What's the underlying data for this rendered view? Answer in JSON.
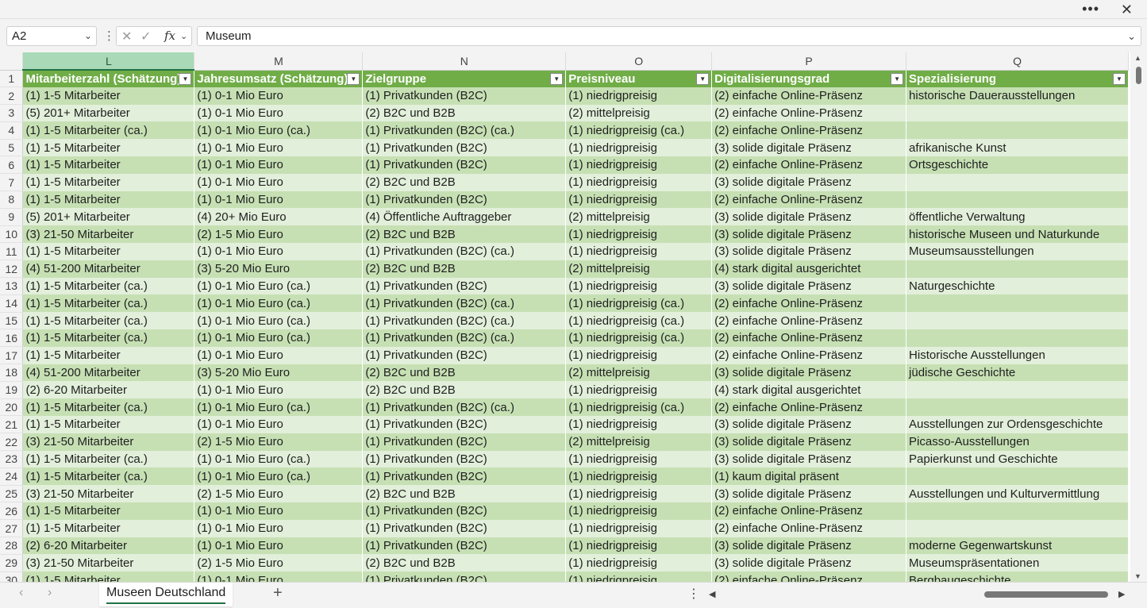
{
  "window": {
    "more_icon": "more-horizontal-icon",
    "close_icon": "close-icon"
  },
  "formula_bar": {
    "name_box": "A2",
    "formula": "Museum"
  },
  "columns": [
    "L",
    "M",
    "N",
    "O",
    "P",
    "Q"
  ],
  "active_column": "L",
  "headers": [
    "Mitarbeiterzahl (Schätzung)",
    "Jahresumsatz (Schätzung)",
    "Zielgruppe",
    "Preisniveau",
    "Digitalisierungsgrad",
    "Spezialisierung"
  ],
  "rows": [
    {
      "n": "2",
      "c": [
        "(1) 1-5 Mitarbeiter",
        "(1) 0-1 Mio Euro",
        "(1) Privatkunden (B2C)",
        "(1) niedrigpreisig",
        "(2) einfache Online-Präsenz",
        "historische Dauerausstellungen"
      ]
    },
    {
      "n": "3",
      "c": [
        "(5) 201+ Mitarbeiter",
        "(1) 0-1 Mio Euro",
        "(2) B2C und B2B",
        "(2) mittelpreisig",
        "(2) einfache Online-Präsenz",
        ""
      ]
    },
    {
      "n": "4",
      "c": [
        "(1) 1-5 Mitarbeiter (ca.)",
        "(1) 0-1 Mio Euro (ca.)",
        "(1) Privatkunden (B2C) (ca.)",
        "(1) niedrigpreisig (ca.)",
        "(2) einfache Online-Präsenz",
        ""
      ]
    },
    {
      "n": "5",
      "c": [
        "(1) 1-5 Mitarbeiter",
        "(1) 0-1 Mio Euro",
        "(1) Privatkunden (B2C)",
        "(1) niedrigpreisig",
        "(3) solide digitale Präsenz",
        "afrikanische Kunst"
      ]
    },
    {
      "n": "6",
      "c": [
        "(1) 1-5 Mitarbeiter",
        "(1) 0-1 Mio Euro",
        "(1) Privatkunden (B2C)",
        "(1) niedrigpreisig",
        "(2) einfache Online-Präsenz",
        "Ortsgeschichte"
      ]
    },
    {
      "n": "7",
      "c": [
        "(1) 1-5 Mitarbeiter",
        "(1) 0-1 Mio Euro",
        "(2) B2C und B2B",
        "(1) niedrigpreisig",
        "(3) solide digitale Präsenz",
        ""
      ]
    },
    {
      "n": "8",
      "c": [
        "(1) 1-5 Mitarbeiter",
        "(1) 0-1 Mio Euro",
        "(1) Privatkunden (B2C)",
        "(1) niedrigpreisig",
        "(2) einfache Online-Präsenz",
        ""
      ]
    },
    {
      "n": "9",
      "c": [
        "(5) 201+ Mitarbeiter",
        "(4) 20+ Mio Euro",
        "(4) Öffentliche Auftraggeber",
        "(2) mittelpreisig",
        "(3) solide digitale Präsenz",
        "öffentliche Verwaltung"
      ]
    },
    {
      "n": "10",
      "c": [
        "(3) 21-50 Mitarbeiter",
        "(2) 1-5 Mio Euro",
        "(2) B2C und B2B",
        "(1) niedrigpreisig",
        "(3) solide digitale Präsenz",
        "historische Museen und Naturkunde"
      ]
    },
    {
      "n": "11",
      "c": [
        "(1) 1-5 Mitarbeiter",
        "(1) 0-1 Mio Euro",
        "(1) Privatkunden (B2C) (ca.)",
        "(1) niedrigpreisig",
        "(3) solide digitale Präsenz",
        "Museumsausstellungen"
      ]
    },
    {
      "n": "12",
      "c": [
        "(4) 51-200 Mitarbeiter",
        "(3) 5-20 Mio Euro",
        "(2) B2C und B2B",
        "(2) mittelpreisig",
        "(4) stark digital ausgerichtet",
        ""
      ]
    },
    {
      "n": "13",
      "c": [
        "(1) 1-5 Mitarbeiter (ca.)",
        "(1) 0-1 Mio Euro (ca.)",
        "(1) Privatkunden (B2C)",
        "(1) niedrigpreisig",
        "(3) solide digitale Präsenz",
        "Naturgeschichte"
      ]
    },
    {
      "n": "14",
      "c": [
        "(1) 1-5 Mitarbeiter (ca.)",
        "(1) 0-1 Mio Euro (ca.)",
        "(1) Privatkunden (B2C) (ca.)",
        "(1) niedrigpreisig (ca.)",
        "(2) einfache Online-Präsenz",
        ""
      ]
    },
    {
      "n": "15",
      "c": [
        "(1) 1-5 Mitarbeiter (ca.)",
        "(1) 0-1 Mio Euro (ca.)",
        "(1) Privatkunden (B2C) (ca.)",
        "(1) niedrigpreisig (ca.)",
        "(2) einfache Online-Präsenz",
        ""
      ]
    },
    {
      "n": "16",
      "c": [
        "(1) 1-5 Mitarbeiter (ca.)",
        "(1) 0-1 Mio Euro (ca.)",
        "(1) Privatkunden (B2C) (ca.)",
        "(1) niedrigpreisig (ca.)",
        "(2) einfache Online-Präsenz",
        ""
      ]
    },
    {
      "n": "17",
      "c": [
        "(1) 1-5 Mitarbeiter",
        "(1) 0-1 Mio Euro",
        "(1) Privatkunden (B2C)",
        "(1) niedrigpreisig",
        "(2) einfache Online-Präsenz",
        "Historische Ausstellungen"
      ]
    },
    {
      "n": "18",
      "c": [
        "(4) 51-200 Mitarbeiter",
        "(3) 5-20 Mio Euro",
        "(2) B2C und B2B",
        "(2) mittelpreisig",
        "(3) solide digitale Präsenz",
        "jüdische Geschichte"
      ]
    },
    {
      "n": "19",
      "c": [
        "(2) 6-20 Mitarbeiter",
        "(1) 0-1 Mio Euro",
        "(2) B2C und B2B",
        "(1) niedrigpreisig",
        "(4) stark digital ausgerichtet",
        ""
      ]
    },
    {
      "n": "20",
      "c": [
        "(1) 1-5 Mitarbeiter (ca.)",
        "(1) 0-1 Mio Euro (ca.)",
        "(1) Privatkunden (B2C) (ca.)",
        "(1) niedrigpreisig (ca.)",
        "(2) einfache Online-Präsenz",
        ""
      ]
    },
    {
      "n": "21",
      "c": [
        "(1) 1-5 Mitarbeiter",
        "(1) 0-1 Mio Euro",
        "(1) Privatkunden (B2C)",
        "(1) niedrigpreisig",
        "(3) solide digitale Präsenz",
        "Ausstellungen zur Ordensgeschichte"
      ]
    },
    {
      "n": "22",
      "c": [
        "(3) 21-50 Mitarbeiter",
        "(2) 1-5 Mio Euro",
        "(1) Privatkunden (B2C)",
        "(2) mittelpreisig",
        "(3) solide digitale Präsenz",
        "Picasso-Ausstellungen"
      ]
    },
    {
      "n": "23",
      "c": [
        "(1) 1-5 Mitarbeiter (ca.)",
        "(1) 0-1 Mio Euro (ca.)",
        "(1) Privatkunden (B2C)",
        "(1) niedrigpreisig",
        "(3) solide digitale Präsenz",
        "Papierkunst und Geschichte"
      ]
    },
    {
      "n": "24",
      "c": [
        "(1) 1-5 Mitarbeiter (ca.)",
        "(1) 0-1 Mio Euro (ca.)",
        "(1) Privatkunden (B2C)",
        "(1) niedrigpreisig",
        "(1) kaum digital präsent",
        ""
      ]
    },
    {
      "n": "25",
      "c": [
        "(3) 21-50 Mitarbeiter",
        "(2) 1-5 Mio Euro",
        "(2) B2C und B2B",
        "(1) niedrigpreisig",
        "(3) solide digitale Präsenz",
        "Ausstellungen und Kulturvermittlung"
      ]
    },
    {
      "n": "26",
      "c": [
        "(1) 1-5 Mitarbeiter",
        "(1) 0-1 Mio Euro",
        "(1) Privatkunden (B2C)",
        "(1) niedrigpreisig",
        "(2) einfache Online-Präsenz",
        ""
      ]
    },
    {
      "n": "27",
      "c": [
        "(1) 1-5 Mitarbeiter",
        "(1) 0-1 Mio Euro",
        "(1) Privatkunden (B2C)",
        "(1) niedrigpreisig",
        "(2) einfache Online-Präsenz",
        ""
      ]
    },
    {
      "n": "28",
      "c": [
        "(2) 6-20 Mitarbeiter",
        "(1) 0-1 Mio Euro",
        "(1) Privatkunden (B2C)",
        "(1) niedrigpreisig",
        "(3) solide digitale Präsenz",
        "moderne Gegenwartskunst"
      ]
    },
    {
      "n": "29",
      "c": [
        "(3) 21-50 Mitarbeiter",
        "(2) 1-5 Mio Euro",
        "(2) B2C und B2B",
        "(1) niedrigpreisig",
        "(3) solide digitale Präsenz",
        "Museumspräsentationen"
      ]
    },
    {
      "n": "30",
      "c": [
        "(1) 1-5 Mitarbeiter",
        "(1) 0-1 Mio Euro",
        "(1) Privatkunden (B2C)",
        "(1) niedrigpreisig",
        "(2) einfache Online-Präsenz",
        "Bergbaugeschichte"
      ]
    }
  ],
  "sheet_tabs": [
    {
      "label": "Museen Deutschland",
      "active": true
    }
  ],
  "colors": {
    "header_fill": "#70ad47",
    "band_dark": "#c6e0b4",
    "band_light": "#e2efda",
    "active_col_header": "#a9d9b7",
    "accent": "#217346"
  }
}
